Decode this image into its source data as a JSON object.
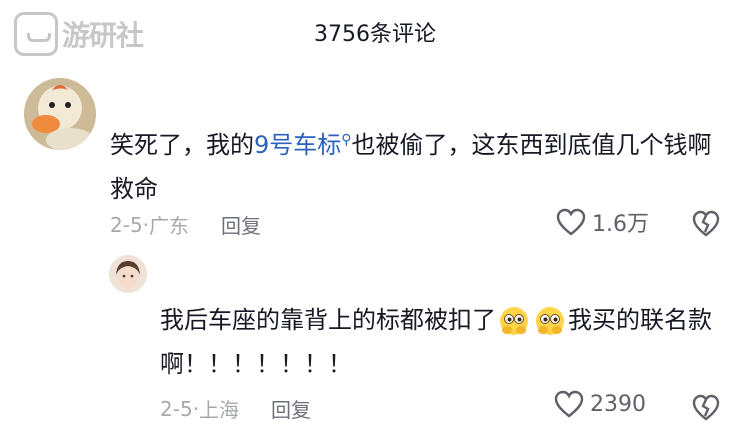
{
  "header": {
    "title": "3756条评论"
  },
  "watermark": {
    "text": "游研社"
  },
  "comments": [
    {
      "text_before": "笑死了，我的",
      "link_text": "9号车标",
      "text_after": "也被偷了，这东西到底值几个钱啊救命",
      "date": "2-5",
      "location": "广东",
      "reply_label": "回复",
      "likes": "1.6万"
    },
    {
      "text_before": "我后车座的靠背上的标都被扣了",
      "text_after": "我买的联名款啊！！！！！！！",
      "date": "2-5",
      "location": "上海",
      "reply_label": "回复",
      "likes": "2390"
    }
  ],
  "icons": {
    "search": "search-icon",
    "heart": "heart-icon",
    "dislike": "broken-heart-icon",
    "emoji": "peeking-face-emoji"
  }
}
